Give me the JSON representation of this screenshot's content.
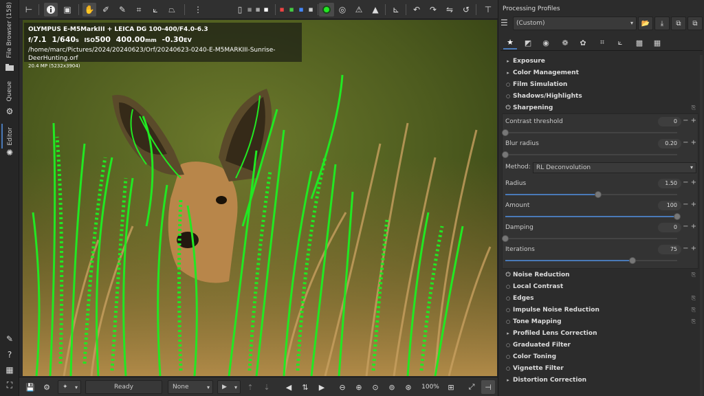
{
  "left_strip": {
    "tabs": [
      {
        "label": "File Browser (158)"
      },
      {
        "label": "Queue"
      },
      {
        "label": "Editor"
      }
    ]
  },
  "top_toolbar": {
    "icons": [
      "compare-icon",
      "info-icon",
      "before-after-icon",
      "hand-icon",
      "eyedropper-icon",
      "picker-icon",
      "crop-icon",
      "straighten-icon",
      "perspective-icon",
      "split-icon",
      "bg-black-icon",
      "bg-gray-icon",
      "bg-white-icon",
      "red-channel-icon",
      "green-channel-icon",
      "blue-channel-icon",
      "luminance-icon",
      "focus-mask-icon",
      "softproof-icon",
      "clip-shadow-icon",
      "clip-highlight-icon",
      "curve-icon",
      "rotate-left-icon",
      "rotate-right-icon",
      "flip-h-icon",
      "flip-v-icon",
      "pin-icon"
    ]
  },
  "image_info": {
    "camera": "OLYMPUS E-M5MarkIII + LEICA DG 100-400/F4.0-6.3",
    "f_prefix": "f/",
    "aperture": "7.1",
    "shutter": "1/640",
    "shutter_unit": "s",
    "iso_label": "ISO",
    "iso": "500",
    "focal": "400.00",
    "focal_unit": "mm",
    "ev": "-0.30",
    "ev_unit": "EV",
    "path": "/home/marc/Pictures/2024/20240623/Orf/20240623-0240-E-M5MARKIII-Sunrise-DeerHunting.orf",
    "megapixels": "20.4 MP (5232x3904)"
  },
  "bottom_toolbar": {
    "status": "Ready",
    "profile_combo": "None",
    "zoom": "100%"
  },
  "right_panel": {
    "title": "Processing Profiles",
    "profile_value": "(Custom)",
    "tools": [
      {
        "name": "Exposure",
        "expanded": false
      },
      {
        "name": "Color Management",
        "expanded": false
      },
      {
        "name": "Film Simulation",
        "expanded": false
      },
      {
        "name": "Shadows/Highlights",
        "expanded": false
      },
      {
        "name": "Sharpening",
        "expanded": true
      },
      {
        "name": "Noise Reduction",
        "expanded": false
      },
      {
        "name": "Local Contrast",
        "expanded": false
      },
      {
        "name": "Edges",
        "expanded": false
      },
      {
        "name": "Impulse Noise Reduction",
        "expanded": false
      },
      {
        "name": "Tone Mapping",
        "expanded": false
      },
      {
        "name": "Profiled Lens Correction",
        "expanded": false
      },
      {
        "name": "Graduated Filter",
        "expanded": false
      },
      {
        "name": "Color Toning",
        "expanded": false
      },
      {
        "name": "Vignette Filter",
        "expanded": false
      },
      {
        "name": "Distortion Correction",
        "expanded": false
      }
    ],
    "sharpening": {
      "contrast_threshold": {
        "label": "Contrast threshold",
        "value": "0",
        "fraction": 0.0
      },
      "blur_radius": {
        "label": "Blur radius",
        "value": "0.20",
        "fraction": 0.0
      },
      "method_label": "Method:",
      "method_value": "RL Deconvolution",
      "radius": {
        "label": "Radius",
        "value": "1.50",
        "fraction": 0.54
      },
      "amount": {
        "label": "Amount",
        "value": "100",
        "fraction": 1.0
      },
      "damping": {
        "label": "Damping",
        "value": "0",
        "fraction": 0.0
      },
      "iterations": {
        "label": "Iterations",
        "value": "75",
        "fraction": 0.74
      }
    }
  },
  "colors": {
    "accent": "#4a7ab8",
    "focus_mask": "#22e822"
  }
}
